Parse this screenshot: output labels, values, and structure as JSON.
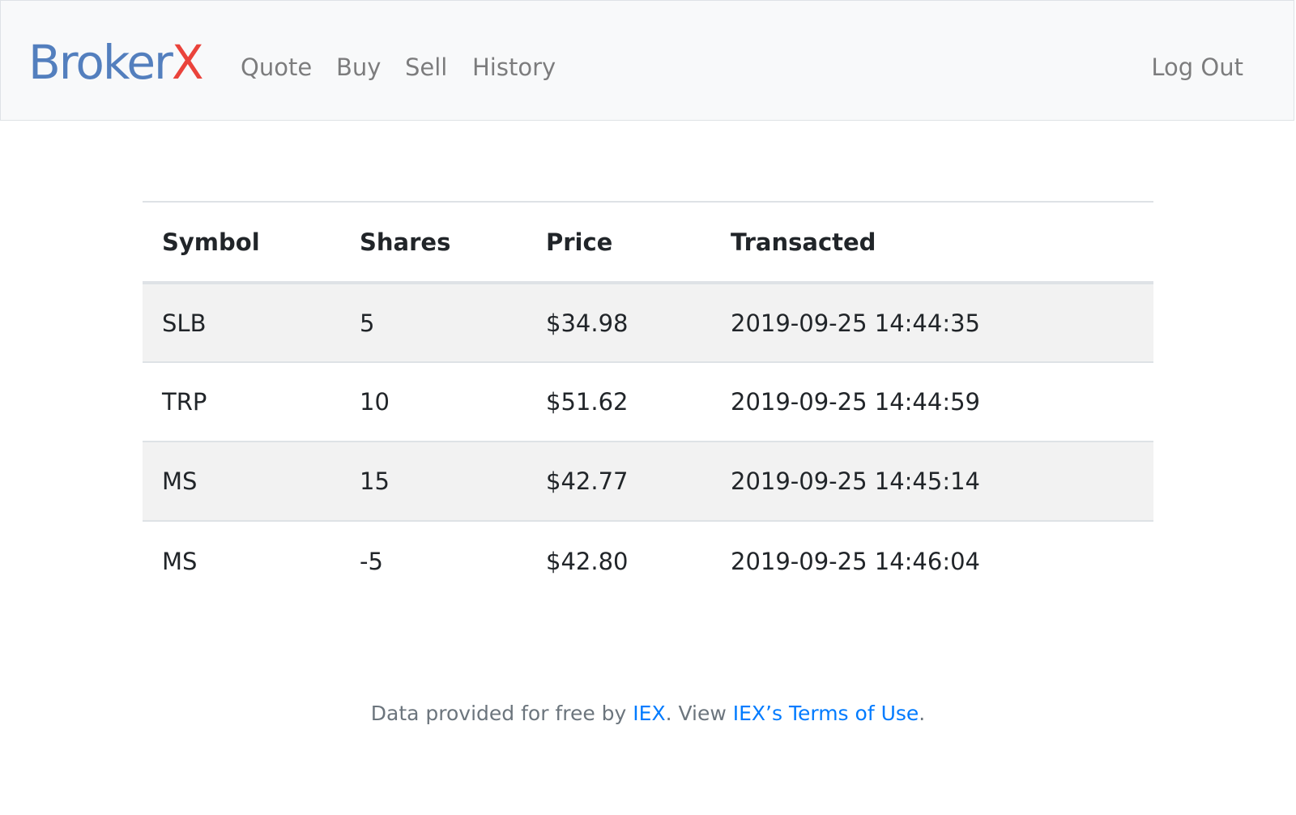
{
  "navbar": {
    "brand_part1": "Broker",
    "brand_part2": "X",
    "brand_colors": {
      "part1": "#537fbe",
      "part2": "#ea433b"
    },
    "links": [
      {
        "label": "Quote"
      },
      {
        "label": "Buy"
      },
      {
        "label": "Sell"
      },
      {
        "label": "History"
      }
    ],
    "logout_label": "Log Out"
  },
  "table": {
    "headers": [
      "Symbol",
      "Shares",
      "Price",
      "Transacted"
    ],
    "rows": [
      {
        "symbol": "SLB",
        "shares": "5",
        "price": "$34.98",
        "transacted": "2019-09-25 14:44:35"
      },
      {
        "symbol": "TRP",
        "shares": "10",
        "price": "$51.62",
        "transacted": "2019-09-25 14:44:59"
      },
      {
        "symbol": "MS",
        "shares": "15",
        "price": "$42.77",
        "transacted": "2019-09-25 14:45:14"
      },
      {
        "symbol": "MS",
        "shares": "-5",
        "price": "$42.80",
        "transacted": "2019-09-25 14:46:04"
      }
    ]
  },
  "footer": {
    "prefix": "Data provided for free by ",
    "iex_link": "IEX",
    "middle": ". View ",
    "terms_link": "IEX’s Terms of Use",
    "suffix": "."
  }
}
